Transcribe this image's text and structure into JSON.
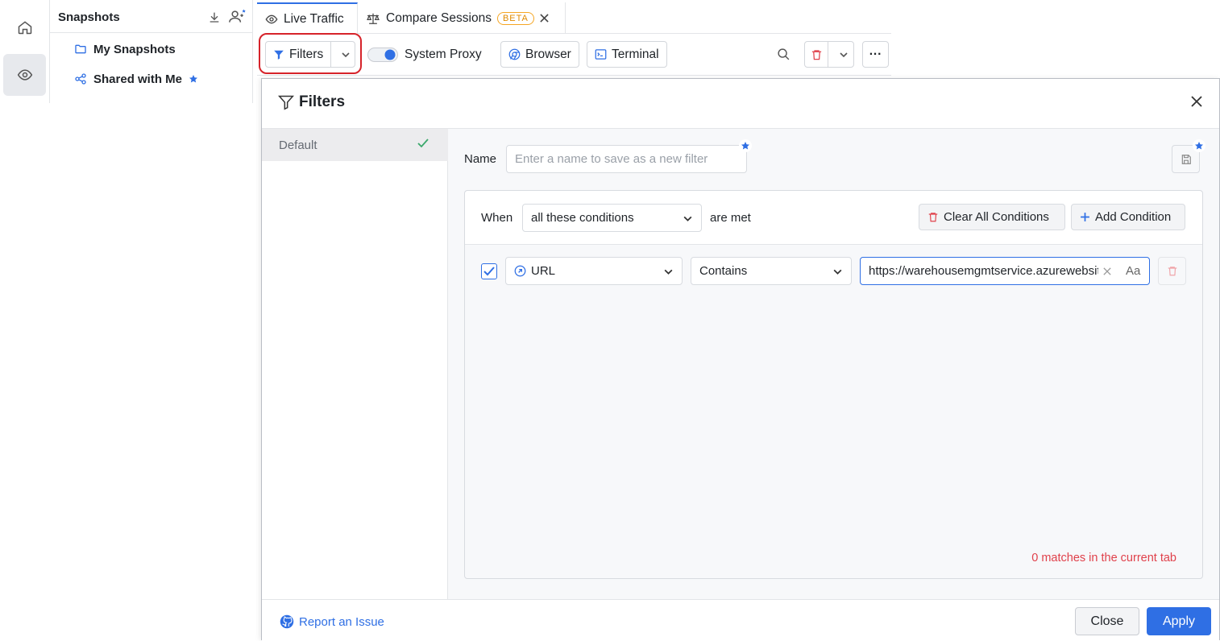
{
  "sidebar": {
    "home_icon": "home-icon",
    "traffic_icon": "eye-icon"
  },
  "snapshots": {
    "title": "Snapshots",
    "items": [
      {
        "label": "My Snapshots",
        "icon": "folder-icon"
      },
      {
        "label": "Shared with Me",
        "icon": "share-icon"
      }
    ]
  },
  "tabs": [
    {
      "label": "Live Traffic",
      "icon": "eye-icon",
      "active": true
    },
    {
      "label": "Compare Sessions",
      "icon": "scale-icon",
      "badge": "BETA"
    }
  ],
  "toolbar": {
    "filters_label": "Filters",
    "system_proxy_label": "System Proxy",
    "system_proxy_on": true,
    "browser_label": "Browser",
    "terminal_label": "Terminal",
    "more_label": "···"
  },
  "modal": {
    "title": "Filters",
    "presets": [
      {
        "label": "Default",
        "selected": true
      }
    ],
    "name_label": "Name",
    "name_placeholder": "Enter a name to save as a new filter",
    "when_label": "When",
    "match_mode": "all these conditions",
    "are_met_label": "are met",
    "clear_all_label": "Clear All Conditions",
    "add_condition_label": "Add Condition",
    "conditions": [
      {
        "enabled": true,
        "field": "URL",
        "operator": "Contains",
        "value": "https://warehousemgmtservice.azurewebsites",
        "case_toggle": "Aa"
      }
    ],
    "matches_text": "0 matches in the current tab",
    "report_label": "Report an Issue",
    "close_label": "Close",
    "apply_label": "Apply"
  },
  "colors": {
    "accent": "#2f6fe4",
    "danger": "#e0414b",
    "highlight": "#d6232a",
    "beta": "#e08a00"
  }
}
